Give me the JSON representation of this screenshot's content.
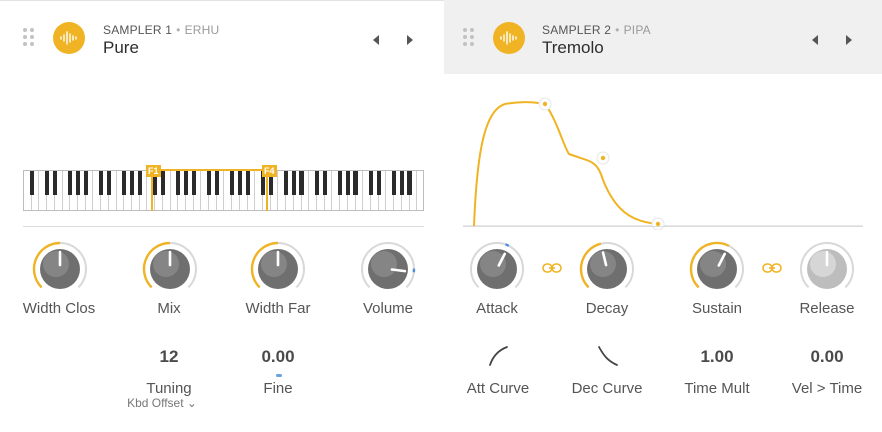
{
  "sampler1": {
    "title": "SAMPLER 1",
    "instrument": "ERHU",
    "preset": "Pure",
    "keyboard": {
      "range_low": "F1",
      "range_high": "F4"
    },
    "knobs": [
      {
        "label": "Width Clos",
        "value_fraction": 0.5
      },
      {
        "label": "Mix",
        "value_fraction": 0.5
      },
      {
        "label": "Width Far",
        "value_fraction": 0.5
      },
      {
        "label": "Volume",
        "value_fraction": 0.86
      }
    ],
    "tuning": {
      "value": "12",
      "label": "Tuning",
      "sub": "Kbd Offset"
    },
    "fine": {
      "value": "0.00",
      "label": "Fine"
    }
  },
  "sampler2": {
    "title": "SAMPLER 2",
    "instrument": "PIPA",
    "preset": "Tremolo",
    "knobs": [
      {
        "label": "Attack",
        "value_fraction": 0.6
      },
      {
        "label": "Decay",
        "value_fraction": 0.45
      },
      {
        "label": "Sustain",
        "value_fraction": 0.6
      },
      {
        "label": "Release",
        "value_fraction": 0.5
      }
    ],
    "att_curve": {
      "label": "Att Curve"
    },
    "dec_curve": {
      "label": "Dec Curve"
    },
    "time_mult": {
      "value": "1.00",
      "label": "Time Mult"
    },
    "vel_time": {
      "value": "0.00",
      "label": "Vel > Time"
    }
  },
  "colors": {
    "accent": "#f0b323",
    "knob_body": "#707070",
    "knob_track": "#d6d6d6",
    "fine_indicator": "#6aa3e0"
  },
  "icons": [
    "drag-handle-icon",
    "waveform-icon",
    "arrow-left-icon",
    "arrow-right-icon",
    "link-icon",
    "chevron-down-icon"
  ]
}
